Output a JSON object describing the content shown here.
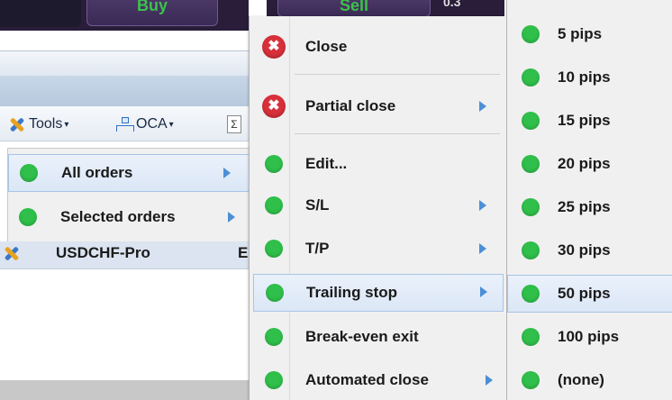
{
  "trade": {
    "buy_label": "Buy",
    "sell_label": "Sell",
    "spread": "0.3"
  },
  "toolbar": {
    "tools_label": "Tools",
    "oca_label": "OCA",
    "sigma": "Σ"
  },
  "orders_menu": {
    "items": [
      {
        "label": "All orders"
      },
      {
        "label": "Selected orders"
      }
    ]
  },
  "position_row": {
    "symbol": "USDCHF-Pro",
    "side_partial": "E"
  },
  "context_menu": {
    "items": [
      {
        "label": "Close",
        "icon": "close-x-icon"
      },
      {
        "label": "Partial close",
        "icon": "close-x-icon"
      },
      {
        "label": "Edit...",
        "icon": "green-dot-icon"
      },
      {
        "label": "S/L",
        "icon": "green-dot-icon"
      },
      {
        "label": "T/P",
        "icon": "green-dot-icon"
      },
      {
        "label": "Trailing stop",
        "icon": "green-dot-icon"
      },
      {
        "label": "Break-even exit",
        "icon": "green-dot-icon"
      },
      {
        "label": "Automated close",
        "icon": "green-dot-icon"
      }
    ]
  },
  "trailing_menu": {
    "items": [
      {
        "label": "5 pips"
      },
      {
        "label": "10 pips"
      },
      {
        "label": "15 pips"
      },
      {
        "label": "20 pips"
      },
      {
        "label": "25 pips"
      },
      {
        "label": "30 pips"
      },
      {
        "label": "50 pips"
      },
      {
        "label": "100 pips"
      },
      {
        "label": "(none)"
      }
    ]
  },
  "colors": {
    "green_dot": "#2fbf4a",
    "close_red": "#d8303a",
    "submenu_arrow": "#4c8fd6",
    "highlight": "#dbe7f6"
  }
}
